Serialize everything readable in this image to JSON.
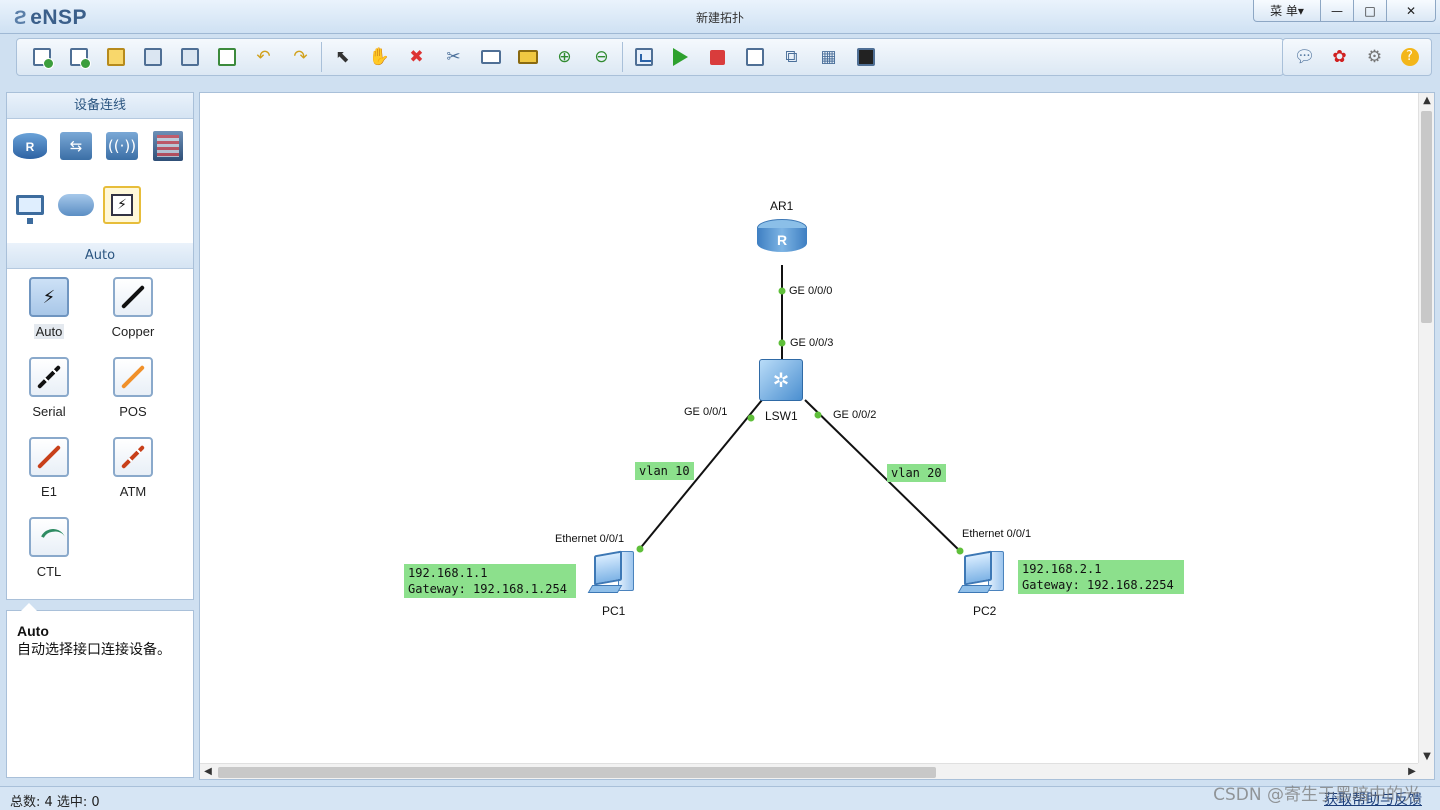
{
  "app": {
    "logo": "eNSP",
    "window_title": "新建拓扑",
    "menu_label": "菜 单▾",
    "minimize": "—",
    "maximize": "□",
    "close": "✕"
  },
  "toolbar": {
    "left_icons": [
      "new-topology-icon",
      "new-example-icon",
      "open-icon",
      "save-icon",
      "save-as-icon",
      "print-icon",
      "undo-icon",
      "redo-icon",
      "select-icon",
      "hand-icon",
      "delete-icon",
      "delete-link-icon",
      "text-icon",
      "rectangle-icon",
      "zoom-in-icon",
      "zoom-out-icon",
      "topology-icon",
      "start-icon",
      "stop-icon",
      "capture-icon",
      "display-interface-icon",
      "grid-icon",
      "screenshot-icon"
    ],
    "right_icons": [
      "chat-icon",
      "huawei-icon",
      "settings-icon",
      "help-icon"
    ]
  },
  "sidebar": {
    "device_header": "设备连线",
    "devices": [
      {
        "name": "router",
        "icon": "router-icon"
      },
      {
        "name": "switch",
        "icon": "switch-icon"
      },
      {
        "name": "wlan",
        "icon": "wlan-icon"
      },
      {
        "name": "firewall",
        "icon": "firewall-icon"
      },
      {
        "name": "pc",
        "icon": "monitor-icon"
      },
      {
        "name": "cloud",
        "icon": "cloud-icon"
      },
      {
        "name": "cable",
        "icon": "lightning-icon",
        "selected": true
      }
    ],
    "cable_header": "Auto",
    "cables": [
      {
        "label": "Auto",
        "color": "#111111",
        "selected": true
      },
      {
        "label": "Copper",
        "color": "#111111"
      },
      {
        "label": "Serial",
        "color": "#111111"
      },
      {
        "label": "POS",
        "color": "#f0902a"
      },
      {
        "label": "E1",
        "color": "#c8401a"
      },
      {
        "label": "ATM",
        "color": "#c8401a"
      },
      {
        "label": "CTL",
        "color": "#2e8b62"
      }
    ]
  },
  "description": {
    "title": "Auto",
    "body": "自动选择接口连接设备。"
  },
  "topology": {
    "nodes": {
      "ar1": "AR1",
      "lsw1": "LSW1",
      "pc1": "PC1",
      "pc2": "PC2"
    },
    "ports": {
      "ar1_ge000": "GE 0/0/0",
      "lsw1_ge003": "GE 0/0/3",
      "lsw1_ge001": "GE 0/0/1",
      "lsw1_ge002": "GE 0/0/2",
      "pc1_eth": "Ethernet 0/0/1",
      "pc2_eth": "Ethernet 0/0/1"
    },
    "tags": {
      "vlan10": "vlan 10",
      "vlan20": "vlan 20",
      "pc1_ip": "192.168.1.1",
      "pc1_gw": "Gateway: 192.168.1.254",
      "pc2_ip": "192.168.2.1",
      "pc2_gw": "Gateway: 192.168.2254"
    },
    "link_color": "#111111",
    "port_dot_color": "#5fbf3a",
    "tag_color": "#8ce08c"
  },
  "statusbar": {
    "left": "总数: 4 选中: 0",
    "right": "获取帮助与反馈",
    "watermark": "CSDN @寄生于黑暗中的光"
  }
}
